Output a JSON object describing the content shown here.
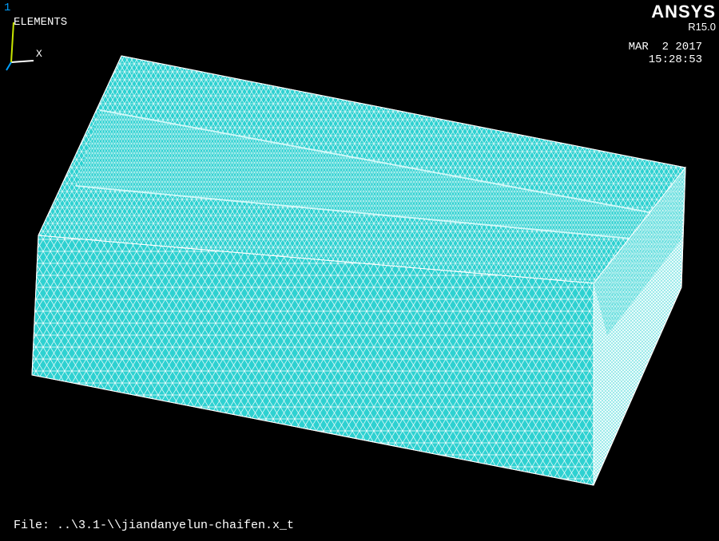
{
  "viewport": {
    "window_number": "1",
    "plot_title": "ELEMENTS",
    "product": {
      "name": "ANSYS",
      "version": "R15.0"
    },
    "date": "MAR  2 2017",
    "time": "15:28:53",
    "file_label": "File: ..\\3.1-\\\\jiandanyelun-chaifen.x_t"
  },
  "triad": {
    "x_label": "X",
    "colors": {
      "x_axis": "#ffffff",
      "y_axis": "#c8e600",
      "z_axis": "#00a0ff"
    }
  },
  "model": {
    "description_color": "#2ed1d1",
    "mesh_line_color": "#ffffff",
    "background": "#000000"
  }
}
